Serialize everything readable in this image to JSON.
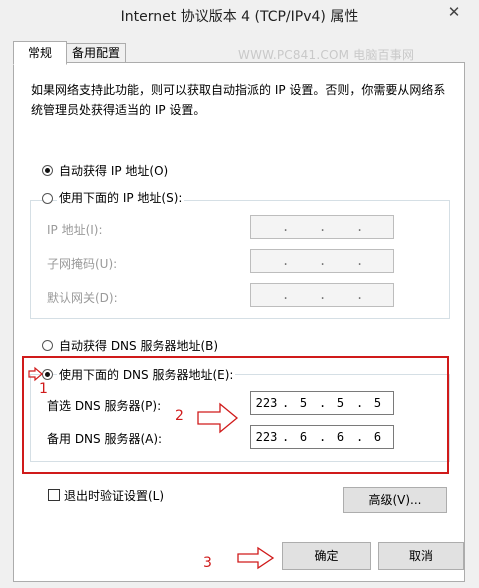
{
  "window": {
    "title": "Internet 协议版本 4 (TCP/IPv4) 属性",
    "close_glyph": "✕"
  },
  "tabs": [
    {
      "label": "常规",
      "active": true
    },
    {
      "label": "备用配置",
      "active": false
    }
  ],
  "watermark": "WWW.PC841.COM 电脑百事网",
  "description": "如果网络支持此功能，则可以获取自动指派的 IP 设置。否则，你需要从网络系统管理员处获得适当的 IP 设置。",
  "ip_section": {
    "auto_label": "自动获得 IP 地址(O)",
    "manual_label": "使用下面的 IP 地址(S):",
    "auto_selected": true,
    "fields": [
      {
        "label": "IP 地址(I):"
      },
      {
        "label": "子网掩码(U):"
      },
      {
        "label": "默认网关(D):"
      }
    ]
  },
  "dns_section": {
    "auto_label": "自动获得 DNS 服务器地址(B)",
    "manual_label": "使用下面的 DNS 服务器地址(E):",
    "manual_selected": true,
    "preferred": {
      "label": "首选 DNS 服务器(P):",
      "octets": [
        "223",
        "5",
        "5",
        "5"
      ]
    },
    "alternate": {
      "label": "备用 DNS 服务器(A):",
      "octets": [
        "223",
        "6",
        "6",
        "6"
      ]
    }
  },
  "validate_label": "退出时验证设置(L)",
  "validate_checked": false,
  "advanced_label": "高级(V)...",
  "ok_label": "确定",
  "cancel_label": "取消",
  "annotations": {
    "step1": "1",
    "step2": "2",
    "step3": "3"
  },
  "colors": {
    "annotation": "#d01a1a",
    "panel": "#ffffff",
    "window": "#f0f0f0"
  }
}
